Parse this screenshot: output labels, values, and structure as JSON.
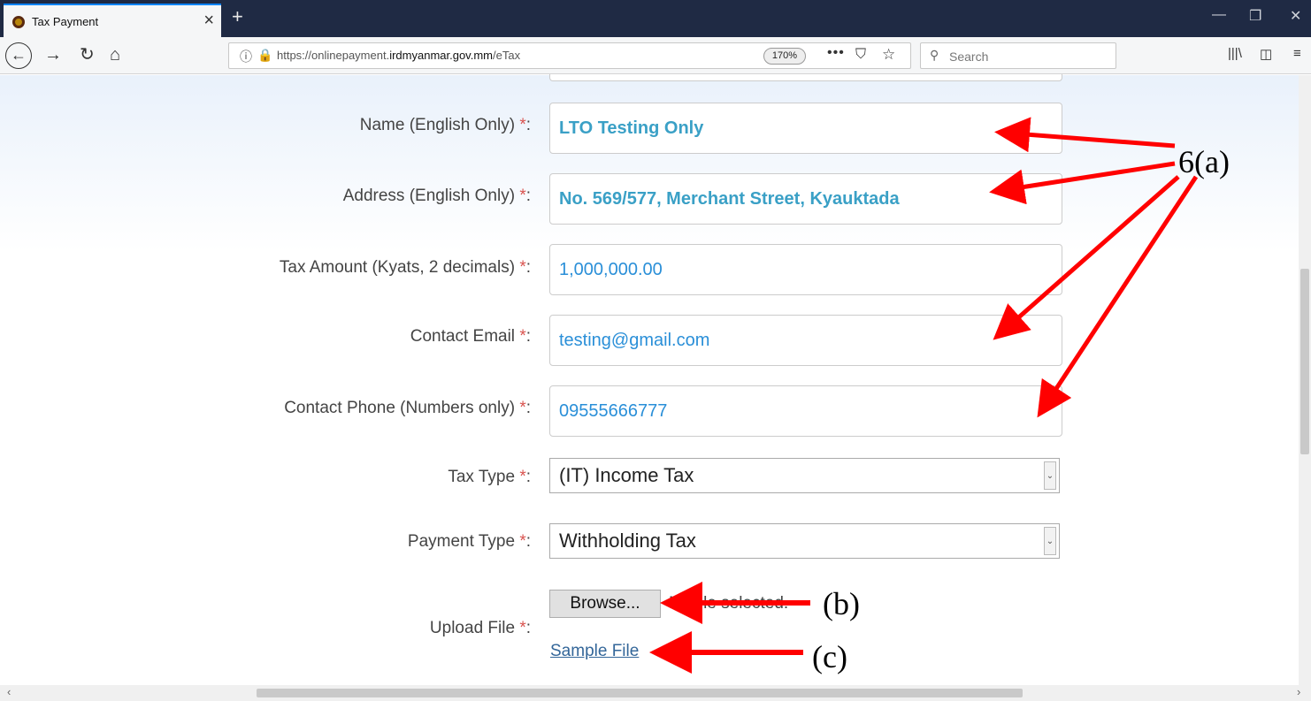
{
  "browser": {
    "tab_title": "Tax Payment",
    "tab_close": "×",
    "new_tab": "+",
    "url_prefix": "https://onlinepayment.",
    "url_domain": "irdmyanmar.gov.mm",
    "url_path": "/eTax",
    "zoom": "170%",
    "search_placeholder": "Search"
  },
  "form": {
    "name_label": "Name (English Only) ",
    "name_value": "LTO Testing Only",
    "address_label": "Address (English Only) ",
    "address_value": "No. 569/577, Merchant Street, Kyauktada",
    "amount_label": "Tax Amount (Kyats, 2 decimals) ",
    "amount_value": "1,000,000.00",
    "email_label": "Contact Email ",
    "email_value": "testing@gmail.com",
    "phone_label": "Contact Phone (Numbers only) ",
    "phone_value": "09555666777",
    "tax_type_label": "Tax Type ",
    "tax_type_value": "(IT) Income Tax",
    "payment_type_label": "Payment Type ",
    "payment_type_value": "Withholding Tax",
    "upload_label": "Upload File ",
    "required_mark": "*",
    "colon": ":",
    "browse_label": "Browse...",
    "no_file_text": "No file selected.",
    "sample_file_link": "Sample File"
  },
  "annotations": {
    "a": "6(a)",
    "b": "(b)",
    "c": "(c)"
  },
  "colors": {
    "arrow": "#ff0000",
    "required": "#d9534f",
    "link": "#336699"
  }
}
